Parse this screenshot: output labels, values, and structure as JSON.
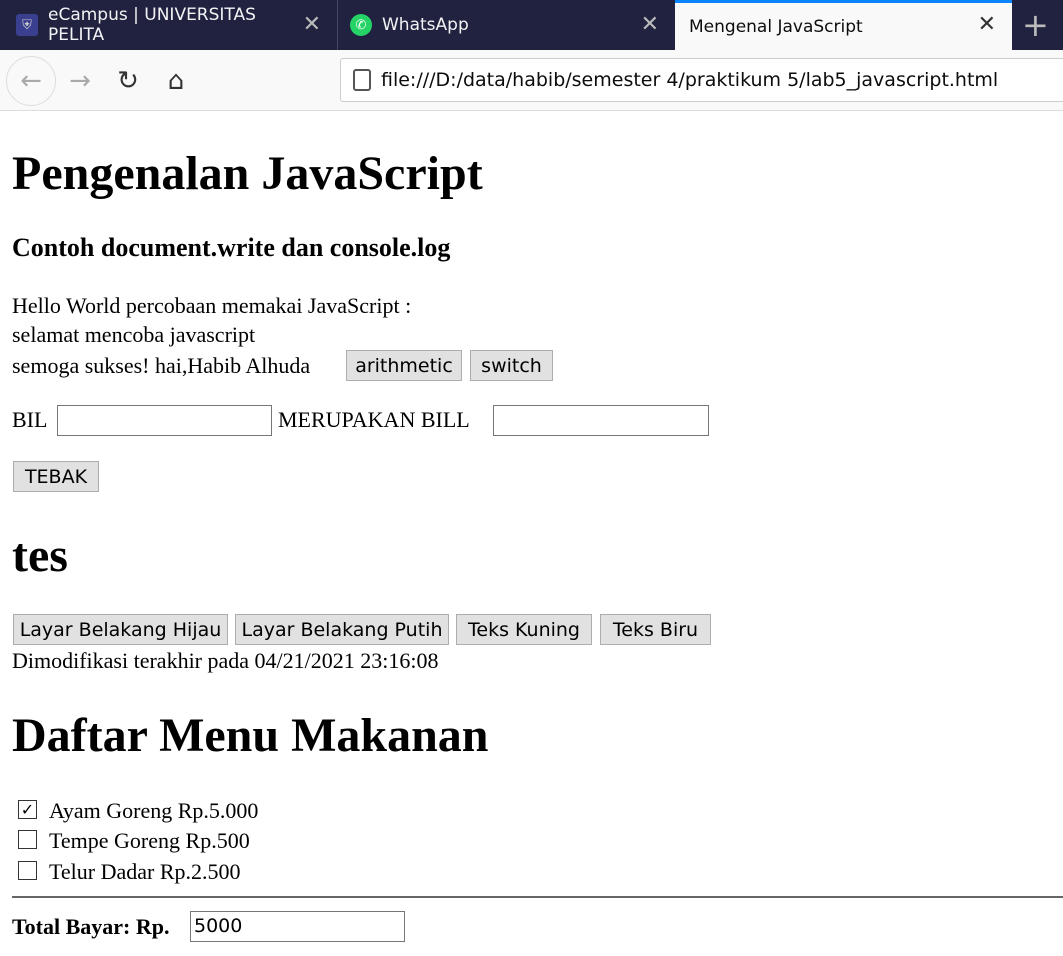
{
  "browser": {
    "tabs": [
      {
        "title": "eCampus | UNIVERSITAS PELITA",
        "icon": "university-logo-icon",
        "active": false
      },
      {
        "title": "WhatsApp",
        "icon": "whatsapp-icon",
        "active": false
      },
      {
        "title": "Mengenal JavaScript",
        "active": true
      }
    ],
    "url": "file:///D:/data/habib/semester 4/praktikum 5/lab5_javascript.html",
    "accent": "#0a84ff"
  },
  "page": {
    "title": "Pengenalan JavaScript",
    "subtitle": "Contoh document.write dan console.log",
    "lines": [
      "Hello World percobaan memakai JavaScript :",
      "selamat mencoba javascript",
      "semoga sukses! hai,Habib Alhuda"
    ],
    "arithmetic_label": "arithmetic",
    "switch_label": "switch",
    "bil_label": "BIL",
    "bil_value": "",
    "merupakan_label": "MERUPAKAN BILL",
    "merupakan_value": "",
    "tebak_label": "TEBAK",
    "tes_heading": "tes",
    "color_buttons": [
      "Layar Belakang Hijau",
      "Layar Belakang Putih",
      "Teks Kuning",
      "Teks Biru"
    ],
    "modified": "Dimodifikasi terakhir pada 04/21/2021 23:16:08",
    "menu_heading": "Daftar Menu Makanan",
    "menu_items": [
      {
        "label": "Ayam Goreng Rp.5.000",
        "checked": true
      },
      {
        "label": "Tempe Goreng Rp.500",
        "checked": false
      },
      {
        "label": "Telur Dadar Rp.2.500",
        "checked": false
      }
    ],
    "total_label": "Total Bayar: Rp.",
    "total_value": "5000"
  }
}
